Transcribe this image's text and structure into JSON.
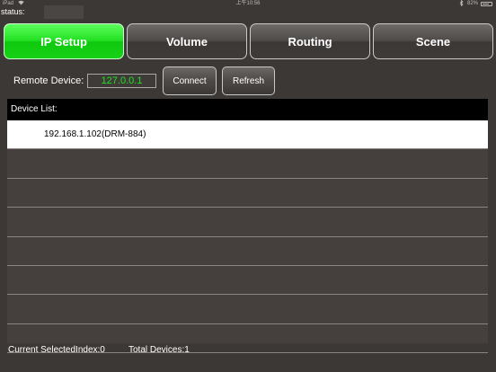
{
  "statusbar": {
    "carrier": "iPad",
    "wifi_icon": "wifi-icon",
    "time": "上午10:56",
    "bluetooth_icon": "bluetooth-icon",
    "battery_percent": "82%",
    "battery_level": 0.82
  },
  "status": {
    "label": "status:",
    "value": ""
  },
  "tabs": [
    {
      "label": "IP Setup",
      "active": true
    },
    {
      "label": "Volume",
      "active": false
    },
    {
      "label": "Routing",
      "active": false
    },
    {
      "label": "Scene",
      "active": false
    }
  ],
  "remote": {
    "label": "Remote Device:",
    "ip": "127.0.0.1",
    "connect_label": "Connect",
    "refresh_label": "Refresh"
  },
  "device_list": {
    "header": "Device List:",
    "items": [
      "192.168.1.102(DRM-884)",
      "",
      "",
      "",
      "",
      "",
      "",
      ""
    ]
  },
  "footer": {
    "selected_index": "Current SelectedIndex:0",
    "total_devices": "Total Devices:1"
  },
  "colors": {
    "active_tab": "#22e022",
    "ip_text": "#23e023",
    "background": "#3c3835"
  }
}
